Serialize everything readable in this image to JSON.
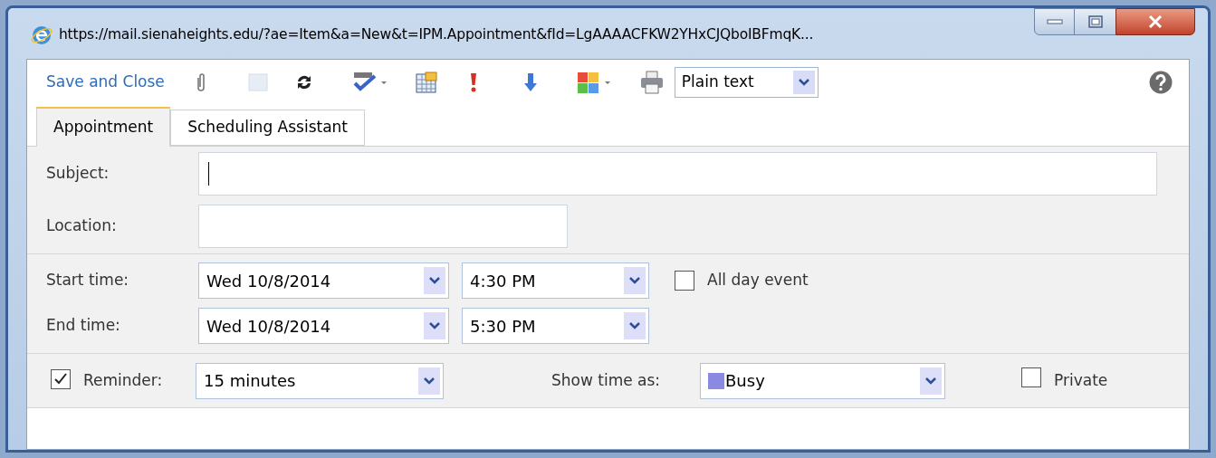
{
  "window": {
    "title": "https://mail.sienaheights.edu/?ae=Item&a=New&t=IPM.Appointment&fId=LgAAAACFKW2YHxCJQboIBFmqK..."
  },
  "toolbar": {
    "save": "Save and Close",
    "format": "Plain text"
  },
  "tabs": [
    {
      "label": "Appointment",
      "selected": true
    },
    {
      "label": "Scheduling Assistant",
      "selected": false
    }
  ],
  "subject": {
    "label": "Subject:",
    "focused": true
  },
  "location": {
    "label": "Location:"
  },
  "start": {
    "label": "Start time:",
    "date": "Wed 10/8/2014",
    "time": "4:30 PM"
  },
  "end": {
    "label": "End time:",
    "date": "Wed 10/8/2014",
    "time": "5:30 PM"
  },
  "all_day": {
    "label": "All day event",
    "checked": false
  },
  "reminder": {
    "label": "Reminder:",
    "checked": true,
    "value": "15 minutes"
  },
  "show_as": {
    "label": "Show time as:",
    "value": "Busy",
    "color": "#8a8ae0"
  },
  "private": {
    "label": "Private",
    "checked": false
  }
}
